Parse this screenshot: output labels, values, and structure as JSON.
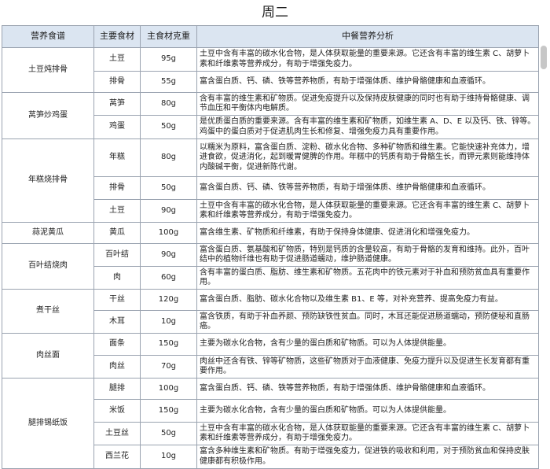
{
  "title": "周二",
  "headers": [
    "营养食谱",
    "主要食材",
    "主食材克重",
    "中餐营养分析"
  ],
  "dishes": [
    {
      "name": "土豆炖排骨",
      "items": [
        {
          "ingredient": "土豆",
          "weight": "95g",
          "analysis": "土豆中含有丰富的碳水化合物，是人体获取能量的重要来源。它还含有丰富的维生素 C、胡萝卜素和纤维素等营养成分，有助于增强免疫力。"
        },
        {
          "ingredient": "排骨",
          "weight": "55g",
          "analysis": "富含蛋白质、钙、磷、铁等营养物质，有助于增强体质、维护骨骼健康和血液循环。"
        }
      ]
    },
    {
      "name": "莴笋炒鸡蛋",
      "items": [
        {
          "ingredient": "莴笋",
          "weight": "80g",
          "analysis": "含有丰富的维生素和矿物质。促进免疫提升以及保持皮肤健康的同时也有助于维持骨骼健康、调节血压和平衡体内电解质。"
        },
        {
          "ingredient": "鸡蛋",
          "weight": "50g",
          "analysis": "是优质蛋白质的重要来源。含有丰富的维生素和矿物质，如维生素 A、D、E 以及钙、铁、锌等。鸡蛋中的蛋白质对于促进肌肉生长和修复、增强免疫力具有重要作用。"
        }
      ]
    },
    {
      "name": "年糕烧排骨",
      "items": [
        {
          "ingredient": "年糕",
          "weight": "80g",
          "analysis": "以糯米为原料，富含蛋白质、淀粉、碳水化合物、多种矿物质和维生素。它能快速补充体力，增进食欲，促进消化，起到暖胃健脾的作用。年糕中的钙质有助于骨骼生长，而钾元素则能维持体内酸碱平衡，促进新陈代谢。"
        },
        {
          "ingredient": "排骨",
          "weight": "50g",
          "analysis": "富含蛋白质、钙、磷、铁等营养物质，有助于增强体质、维护骨骼健康和血液循环。"
        },
        {
          "ingredient": "土豆",
          "weight": "90g",
          "analysis": "土豆中含有丰富的碳水化合物，是人体获取能量的重要来源。它还含有丰富的维生素 C、胡萝卜素和纤维素等营养成分，有助于增强免疫力。"
        }
      ]
    },
    {
      "name": "蒜泥黄瓜",
      "items": [
        {
          "ingredient": "黄瓜",
          "weight": "100g",
          "analysis": "富含维生素、矿物质和纤维素，有助于保持身体健康、促进消化和增强免疫力。"
        }
      ]
    },
    {
      "name": "百叶结烧肉",
      "items": [
        {
          "ingredient": "百叶结",
          "weight": "90g",
          "analysis": "富含蛋白质、氨基酸和矿物质，特别是钙质的含量较高，有助于骨骼的发育和维持。此外，百叶结中的植物纤维也有助于促进肠道蠕动，维护肠道健康。"
        },
        {
          "ingredient": "肉",
          "weight": "60g",
          "analysis": "含有丰富的蛋白质、脂肪、维生素和矿物质。五花肉中的铁元素对于补血和预防贫血具有重要作用。"
        }
      ]
    },
    {
      "name": "煮干丝",
      "items": [
        {
          "ingredient": "干丝",
          "weight": "120g",
          "analysis": "富含蛋白质、脂肪、碳水化合物以及维生素 B1、E 等，对补充营养、提高免疫力有益。"
        },
        {
          "ingredient": "木耳",
          "weight": "10g",
          "analysis": "富含铁质，有助于补血养颜、预防缺铁性贫血。同时，木耳还能促进肠道蠕动，预防便秘和直肠癌。"
        }
      ]
    },
    {
      "name": "肉丝面",
      "items": [
        {
          "ingredient": "面条",
          "weight": "150g",
          "analysis": "主要为碳水化合物，含有少量的蛋白质和矿物质。可以为人体提供能量。"
        },
        {
          "ingredient": "肉丝",
          "weight": "70g",
          "analysis": "肉丝中还含有铁、锌等矿物质，这些矿物质对于血液健康、免疫力提升以及促进生长发育都有重要作用。"
        }
      ]
    },
    {
      "name": "腿排锡纸饭",
      "items": [
        {
          "ingredient": "腿排",
          "weight": "100g",
          "analysis": "富含蛋白质、钙、磷、铁等营养物质，有助于增强体质、维护骨骼健康和血液循环。"
        },
        {
          "ingredient": "米饭",
          "weight": "150g",
          "analysis": "主要为碳水化合物，含有少量的蛋白质和矿物质。可以为人体提供能量。"
        },
        {
          "ingredient": "土豆丝",
          "weight": "50g",
          "analysis": "土豆中含有丰富的碳水化合物，是人体获取能量的重要来源。它还含有丰富的维生素 C、胡萝卜素和纤维素等营养成分，有助于增强免疫力。"
        },
        {
          "ingredient": "西兰花",
          "weight": "10g",
          "analysis": "富含多种维生素和矿物质。有助于增强免疫力，促进铁的吸收和利用，对于预防贫血和保持皮肤健康都有积极作用。"
        }
      ]
    }
  ]
}
